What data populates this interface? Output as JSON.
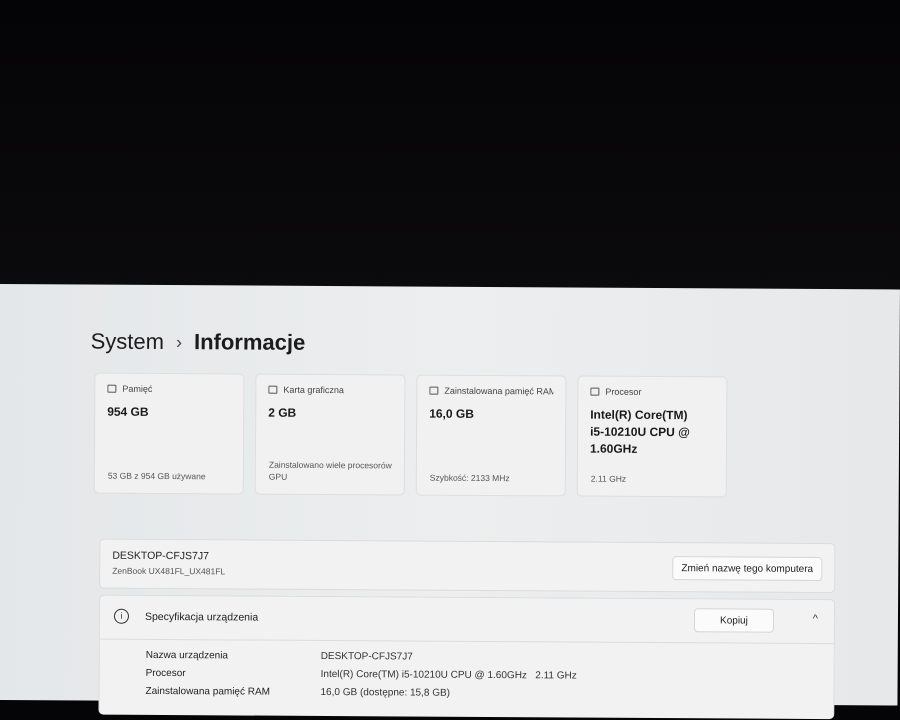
{
  "breadcrumb": {
    "parent": "System",
    "separator": "›",
    "current": "Informacje"
  },
  "cards": [
    {
      "icon": "storage-icon",
      "label": "Pamięć",
      "value": "954 GB",
      "footer": "53 GB z 954 GB używane"
    },
    {
      "icon": "gpu-icon",
      "label": "Karta graficzna",
      "value": "2 GB",
      "footer": "Zainstalowano wiele procesorów GPU"
    },
    {
      "icon": "ram-icon",
      "label": "Zainstalowana pamięć RAM",
      "value": "16,0 GB",
      "footer": "Szybkość: 2133 MHz"
    },
    {
      "icon": "processor-icon",
      "label": "Procesor",
      "value": "Intel(R) Core(TM) i5-10210U CPU @ 1.60GHz",
      "footer": "2.11 GHz"
    }
  ],
  "device": {
    "name": "DESKTOP-CFJS7J7",
    "model": "ZenBook UX481FL_UX481FL",
    "rename_label": "Zmień nazwę tego komputera"
  },
  "specs": {
    "title": "Specyfikacja urządzenia",
    "info_glyph": "i",
    "copy_label": "Kopiuj",
    "collapse_glyph": "^",
    "rows": [
      {
        "label": "Nazwa urządzenia",
        "value": "DESKTOP-CFJS7J7"
      },
      {
        "label": "Procesor",
        "value": "Intel(R) Core(TM) i5-10210U CPU @ 1.60GHz   2.11 GHz"
      },
      {
        "label": "Zainstalowana pamięć RAM",
        "value": "16,0 GB (dostępne: 15,8 GB)"
      }
    ]
  }
}
